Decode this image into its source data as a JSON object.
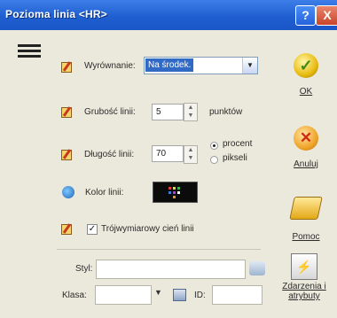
{
  "window": {
    "title": "Pozioma linia <HR>",
    "help_btn": "?",
    "close_btn": "X"
  },
  "fields": {
    "alignment": {
      "label": "Wyrównanie:",
      "value": "Na środek."
    },
    "thickness": {
      "label": "Grubość linii:",
      "value": "5",
      "unit": "punktów"
    },
    "length": {
      "label": "Długość linii:",
      "value": "70",
      "options": [
        "procent",
        "pikseli"
      ],
      "selected": "procent"
    },
    "color": {
      "label": "Kolor linii:"
    },
    "shadow": {
      "label": "Trójwymiarowy cień linii",
      "checked": true
    },
    "style": {
      "label": "Styl:",
      "value": ""
    },
    "class": {
      "label": "Klasa:",
      "value": ""
    },
    "id": {
      "label": "ID:",
      "value": ""
    }
  },
  "buttons": {
    "ok": "OK",
    "cancel": "Anuluj",
    "help": "Pomoc",
    "events": "Zdarzenia i atrybuty"
  },
  "icons": {
    "lines": "horizontal-lines-icon",
    "pencil": "pencil-edit-icon",
    "globe": "ie-globe-icon",
    "keys": "keys-icon",
    "small_folder": "folder-icon"
  }
}
